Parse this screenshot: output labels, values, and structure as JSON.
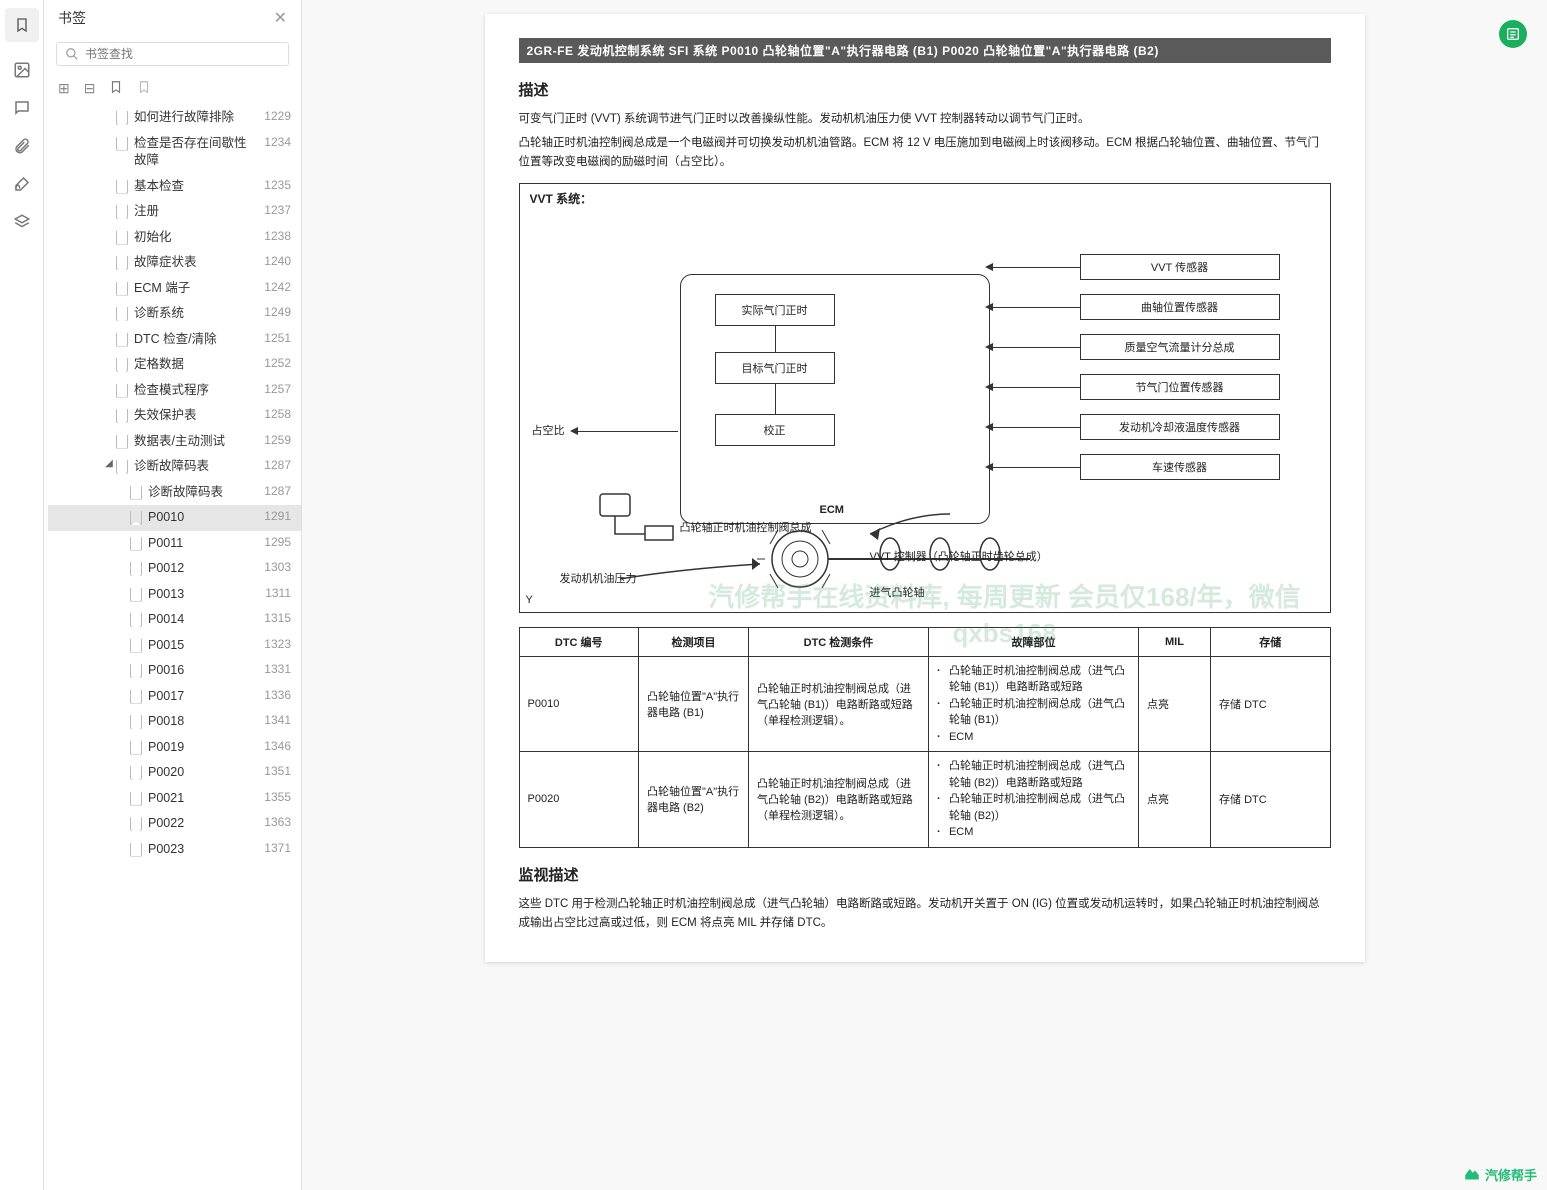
{
  "sidebar": {
    "title": "书签",
    "search_placeholder": "书签查找"
  },
  "tree": [
    {
      "label": "如何进行故障排除",
      "page": "1229",
      "indent": 2
    },
    {
      "label": "检查是否存在间歇性故障",
      "page": "1234",
      "indent": 2
    },
    {
      "label": "基本检查",
      "page": "1235",
      "indent": 2
    },
    {
      "label": "注册",
      "page": "1237",
      "indent": 2
    },
    {
      "label": "初始化",
      "page": "1238",
      "indent": 2
    },
    {
      "label": "故障症状表",
      "page": "1240",
      "indent": 2
    },
    {
      "label": "ECM 端子",
      "page": "1242",
      "indent": 2
    },
    {
      "label": "诊断系统",
      "page": "1249",
      "indent": 2
    },
    {
      "label": "DTC 检查/清除",
      "page": "1251",
      "indent": 2
    },
    {
      "label": "定格数据",
      "page": "1252",
      "indent": 2
    },
    {
      "label": "检查模式程序",
      "page": "1257",
      "indent": 2
    },
    {
      "label": "失效保护表",
      "page": "1258",
      "indent": 2
    },
    {
      "label": "数据表/主动测试",
      "page": "1259",
      "indent": 2
    },
    {
      "label": "诊断故障码表",
      "page": "1287",
      "indent": 2,
      "expanded": true
    },
    {
      "label": "诊断故障码表",
      "page": "1287",
      "indent": 3
    },
    {
      "label": "P0010",
      "page": "1291",
      "indent": 3,
      "selected": true
    },
    {
      "label": "P0011",
      "page": "1295",
      "indent": 3
    },
    {
      "label": "P0012",
      "page": "1303",
      "indent": 3
    },
    {
      "label": "P0013",
      "page": "1311",
      "indent": 3
    },
    {
      "label": "P0014",
      "page": "1315",
      "indent": 3
    },
    {
      "label": "P0015",
      "page": "1323",
      "indent": 3
    },
    {
      "label": "P0016",
      "page": "1331",
      "indent": 3
    },
    {
      "label": "P0017",
      "page": "1336",
      "indent": 3
    },
    {
      "label": "P0018",
      "page": "1341",
      "indent": 3
    },
    {
      "label": "P0019",
      "page": "1346",
      "indent": 3
    },
    {
      "label": "P0020",
      "page": "1351",
      "indent": 3
    },
    {
      "label": "P0021",
      "page": "1355",
      "indent": 3
    },
    {
      "label": "P0022",
      "page": "1363",
      "indent": 3
    },
    {
      "label": "P0023",
      "page": "1371",
      "indent": 3
    }
  ],
  "doc": {
    "header": "2GR-FE 发动机控制系统  SFI 系统  P0010 凸轮轴位置\"A\"执行器电路 (B1)  P0020 凸轮轴位置\"A\"执行器电路 (B2)",
    "s1_title": "描述",
    "p1": "可变气门正时 (VVT) 系统调节进气门正时以改善操纵性能。发动机机油压力使 VVT 控制器转动以调节气门正时。",
    "p2": "凸轮轴正时机油控制阀总成是一个电磁阀并可切换发动机机油管路。ECM 将 12 V 电压施加到电磁阀上时该阀移动。ECM 根据凸轮轴位置、曲轴位置、节气门位置等改变电磁阀的励磁时间（占空比）。",
    "diagram": {
      "title": "VVT 系统：",
      "ecm": "ECM",
      "actual": "实际气门正时",
      "target": "目标气门正时",
      "correct": "校正",
      "duty": "占空比",
      "sensors": [
        "VVT 传感器",
        "曲轴位置传感器",
        "质量空气流量计分总成",
        "节气门位置传感器",
        "发动机冷却液温度传感器",
        "车速传感器"
      ],
      "oilvalve": "凸轮轴正时机油控制阀总成",
      "oilpressure": "发动机机油压力",
      "controller": "VVT 控制器（凸轮轴正时齿轮总成）",
      "camshaft": "进气凸轮轴",
      "y": "Y"
    },
    "table": {
      "headers": [
        "DTC 编号",
        "检测项目",
        "DTC 检测条件",
        "故障部位",
        "MIL",
        "存储"
      ],
      "rows": [
        {
          "code": "P0010",
          "item": "凸轮轴位置\"A\"执行器电路 (B1)",
          "cond": "凸轮轴正时机油控制阀总成（进气凸轮轴 (B1)）电路断路或短路（单程检测逻辑）。",
          "area": [
            "凸轮轴正时机油控制阀总成（进气凸轮轴 (B1)）电路断路或短路",
            "凸轮轴正时机油控制阀总成（进气凸轮轴 (B1)）",
            "ECM"
          ],
          "mil": "点亮",
          "store": "存储 DTC"
        },
        {
          "code": "P0020",
          "item": "凸轮轴位置\"A\"执行器电路 (B2)",
          "cond": "凸轮轴正时机油控制阀总成（进气凸轮轴 (B2)）电路断路或短路（单程检测逻辑）。",
          "area": [
            "凸轮轴正时机油控制阀总成（进气凸轮轴 (B2)）电路断路或短路",
            "凸轮轴正时机油控制阀总成（进气凸轮轴 (B2)）",
            "ECM"
          ],
          "mil": "点亮",
          "store": "存储 DTC"
        }
      ]
    },
    "s2_title": "监视描述",
    "p3": "这些 DTC 用于检测凸轮轴正时机油控制阀总成（进气凸轮轴）电路断路或短路。发动机开关置于 ON (IG) 位置或发动机运转时，如果凸轮轴正时机油控制阀总成输出占空比过高或过低，则 ECM 将点亮 MIL 并存储 DTC。",
    "watermark_ghost": "汽修帮手在线资料库, 每周更新\n会员仅168/年，微信qxbs168",
    "watermark": "汽修帮手"
  }
}
